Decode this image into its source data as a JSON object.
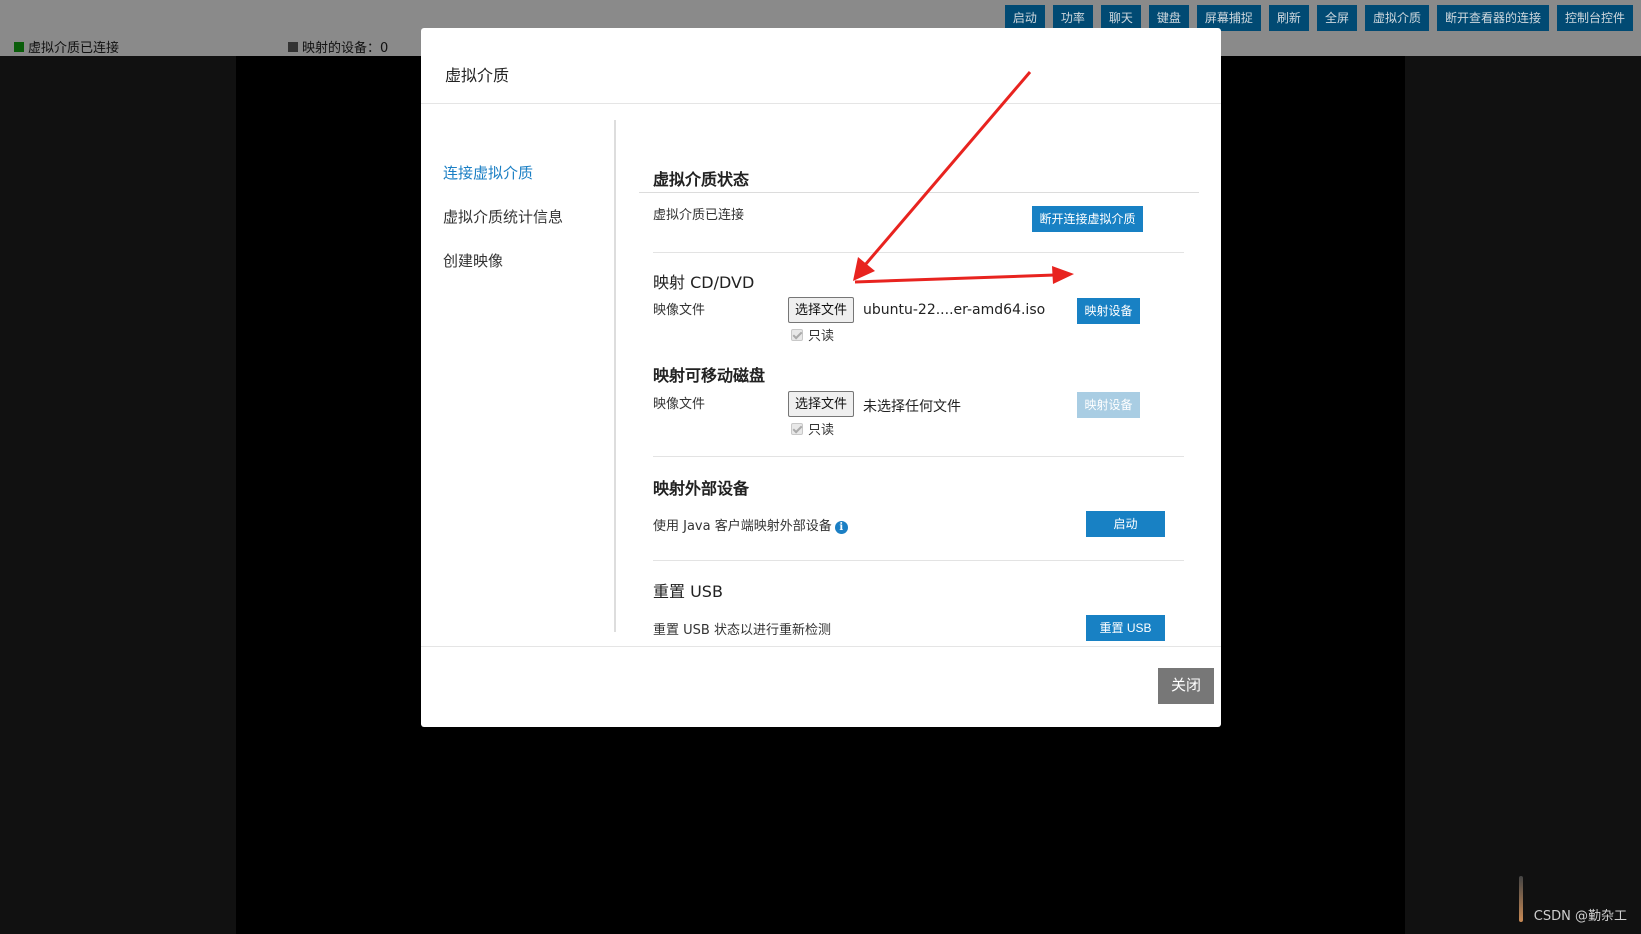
{
  "status": {
    "connected": "虚拟介质已连接",
    "mapped_devices": "映射的设备：0"
  },
  "toolbar": [
    "启动",
    "功率",
    "聊天",
    "键盘",
    "屏幕捕捉",
    "刷新",
    "全屏",
    "虚拟介质",
    "断开查看器的连接",
    "控制台控件"
  ],
  "modal": {
    "title": "虚拟介质",
    "nav": [
      "连接虚拟介质",
      "虚拟介质统计信息",
      "创建映像"
    ],
    "status_section": {
      "title": "虚拟介质状态",
      "text": "虚拟介质已连接",
      "disconnect_label": "断开连接虚拟介质"
    },
    "cd_section": {
      "title": "映射 CD/DVD",
      "image_label": "映像文件",
      "choose_label": "选择文件",
      "file_name": "ubuntu-22....er-amd64.iso",
      "readonly_label": "只读",
      "map_label": "映射设备"
    },
    "removable_section": {
      "title": "映射可移动磁盘",
      "image_label": "映像文件",
      "choose_label": "选择文件",
      "file_name": "未选择任何文件",
      "readonly_label": "只读",
      "map_label": "映射设备"
    },
    "external_section": {
      "title": "映射外部设备",
      "text": "使用 Java 客户端映射外部设备",
      "start_label": "启动"
    },
    "usb_section": {
      "title": "重置 USB",
      "text": "重置 USB 状态以进行重新检测",
      "reset_label": "重置 USB"
    },
    "close_label": "关闭"
  },
  "watermark": "CSDN @勤杂工",
  "colors": {
    "accent": "#1881c4",
    "annotation_arrow": "#e8231f",
    "toolbar_button": "#014a73"
  },
  "icons": [
    "info-icon"
  ]
}
